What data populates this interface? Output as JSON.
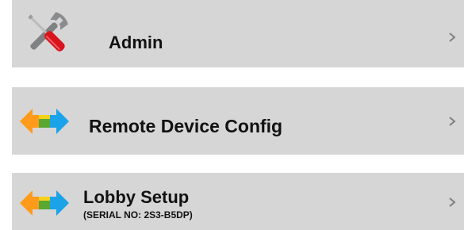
{
  "menu": {
    "items": [
      {
        "label": "Admin",
        "icon": "tools-icon"
      },
      {
        "label": "Remote Device Config",
        "icon": "sync-arrows-icon"
      },
      {
        "label": "Lobby Setup",
        "sublabel": "(SERIAL NO: 2S3-B5DP)",
        "icon": "sync-arrows-icon"
      }
    ],
    "chevron_icon": "chevron-right-icon"
  },
  "colors": {
    "row_background": "#d6d6d6",
    "arrow_orange": "#ff9a1a",
    "arrow_blue": "#1aa3e8",
    "screwdriver_red": "#d9141c",
    "wrench_gray": "#7f8183",
    "chevron": "#808080"
  }
}
